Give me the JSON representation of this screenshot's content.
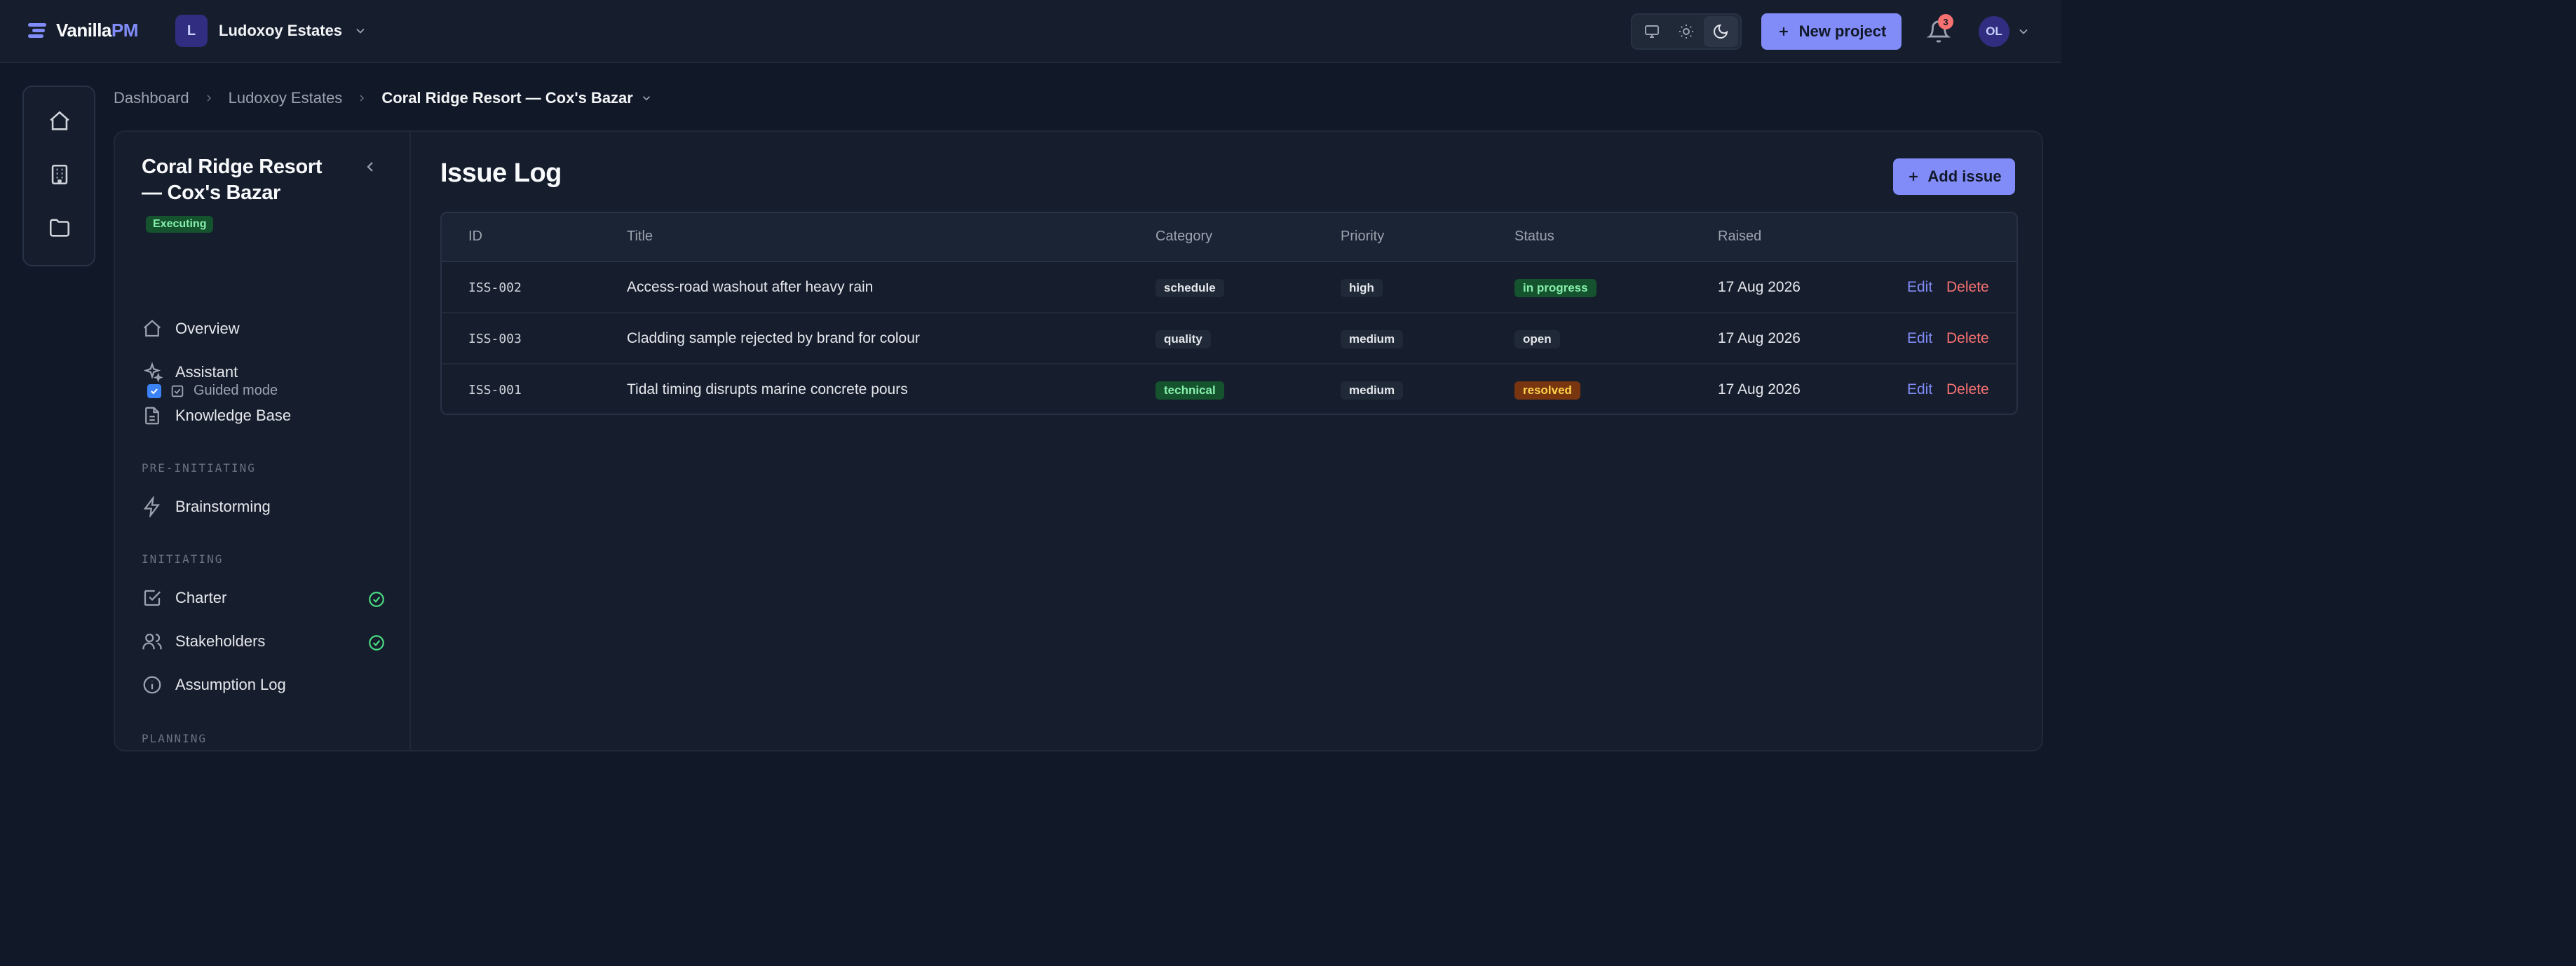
{
  "brand": {
    "name_main": "Vanilla",
    "name_accent": "PM"
  },
  "org": {
    "initial": "L",
    "name": "Ludoxoy Estates"
  },
  "topbar": {
    "new_project_label": "New project",
    "notification_count": "3",
    "user_initials": "OL"
  },
  "breadcrumb": [
    "Dashboard",
    "Ludoxoy Estates",
    "Coral Ridge Resort — Cox's Bazar"
  ],
  "project": {
    "title": "Coral Ridge Resort — Cox's Bazar",
    "status": "Executing",
    "guided_mode_label": "Guided mode"
  },
  "nav": {
    "overview": "Overview",
    "assistant": "Assistant",
    "knowledge_base": "Knowledge Base",
    "section_pre_initiating": "PRE-INITIATING",
    "brainstorming": "Brainstorming",
    "section_initiating": "INITIATING",
    "charter": "Charter",
    "stakeholders": "Stakeholders",
    "assumption_log": "Assumption Log",
    "section_planning": "PLANNING"
  },
  "page": {
    "title": "Issue Log",
    "add_label": "Add issue"
  },
  "table": {
    "headers": {
      "id": "ID",
      "title": "Title",
      "category": "Category",
      "priority": "Priority",
      "status": "Status",
      "raised": "Raised"
    },
    "rows": [
      {
        "id": "ISS-002",
        "title": "Access-road washout after heavy rain",
        "category": "schedule",
        "priority": "high",
        "status": "in progress",
        "raised": "17 Aug 2026",
        "edit": "Edit",
        "delete": "Delete"
      },
      {
        "id": "ISS-003",
        "title": "Cladding sample rejected by brand for colour",
        "category": "quality",
        "priority": "medium",
        "status": "open",
        "raised": "17 Aug 2026",
        "edit": "Edit",
        "delete": "Delete"
      },
      {
        "id": "ISS-001",
        "title": "Tidal timing disrupts marine concrete pours",
        "category": "technical",
        "priority": "medium",
        "status": "resolved",
        "raised": "17 Aug 2026",
        "edit": "Edit",
        "delete": "Delete"
      }
    ]
  },
  "colors": {
    "accent": "#818cf8",
    "success": "#86efac",
    "warning": "#fcd34d",
    "danger": "#f87171",
    "background": "#111827",
    "panel": "#161e2e"
  }
}
